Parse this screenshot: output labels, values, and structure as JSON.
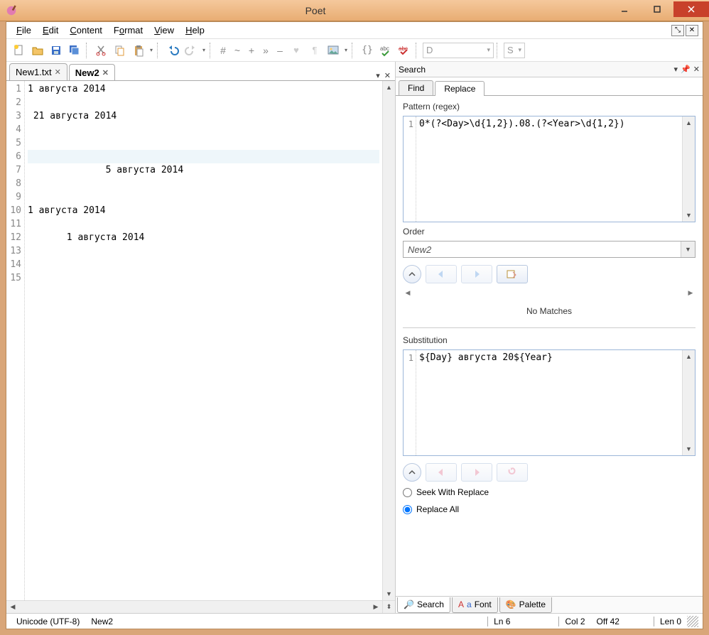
{
  "window": {
    "title": "Poet"
  },
  "menu": {
    "file": "File",
    "edit": "Edit",
    "content": "Content",
    "format": "Format",
    "view": "View",
    "help": "Help"
  },
  "toolbar": {
    "symbols": {
      "hash": "#",
      "tilde": "~",
      "plus": "+",
      "raquo": "»",
      "ndash": "–"
    },
    "dbox": "D",
    "sbox": "S"
  },
  "tabs": {
    "items": [
      {
        "label": "New1.txt",
        "active": false
      },
      {
        "label": "New2",
        "active": true
      }
    ]
  },
  "editor": {
    "lines": [
      "1 августа 2014",
      "",
      " 21 августа 2014",
      "",
      "",
      "",
      "              5 августа 2014",
      "",
      "",
      "1 августа 2014",
      "",
      "       1 августа 2014",
      "",
      ""
    ],
    "current_line_index": 5,
    "first_line_number": 1
  },
  "search_panel": {
    "title": "Search",
    "find_tab": "Find",
    "replace_tab": "Replace",
    "pattern_label": "Pattern (regex)",
    "pattern_value": "0*(?<Day>\\d{1,2}).08.(?<Year>\\d{1,2})",
    "order_label": "Order",
    "order_value": "New2",
    "no_matches": "No Matches",
    "substitution_label": "Substitution",
    "substitution_value": "${Day} августа 20${Year}",
    "seek_label": "Seek With Replace",
    "replace_all_label": "Replace All",
    "replace_mode": "replace_all"
  },
  "bottom_tabs": {
    "search": "Search",
    "font": "Font",
    "palette": "Palette"
  },
  "status": {
    "encoding": "Unicode (UTF-8)",
    "doc": "New2",
    "ln": "Ln 6",
    "col": "Col 2",
    "off": "Off 42",
    "len": "Len 0"
  }
}
